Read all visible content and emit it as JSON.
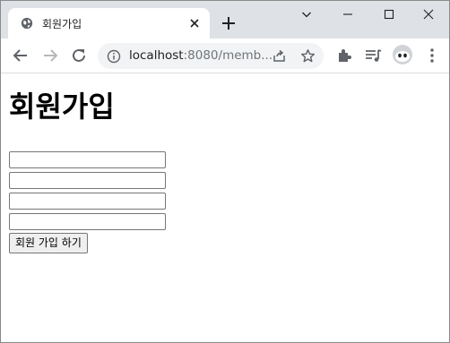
{
  "browser": {
    "tab": {
      "title": "회원가입"
    },
    "address_bar": {
      "host": "localhost",
      "rest": ":8080/memb..."
    },
    "accent_colors": {
      "tabstrip": "#dee1e6",
      "omnibox": "#f1f3f4"
    }
  },
  "page": {
    "title": "회원가입",
    "fields": [
      {
        "value": "",
        "placeholder": ""
      },
      {
        "value": "",
        "placeholder": ""
      },
      {
        "value": "",
        "placeholder": ""
      },
      {
        "value": "",
        "placeholder": ""
      }
    ],
    "submit_label": "회원 가입 하기"
  },
  "icons": {
    "favicon": "globe-icon",
    "tab_close": "close-icon",
    "new_tab": "plus-icon",
    "tab_search": "chevron-down-icon",
    "minimize": "minimize-icon",
    "maximize": "maximize-icon",
    "close_window": "close-icon",
    "back": "arrow-left-icon",
    "forward": "arrow-right-icon",
    "reload": "reload-icon",
    "site_info": "info-icon",
    "share": "share-icon",
    "bookmark": "star-icon",
    "extensions": "puzzle-icon",
    "media": "media-playlist-icon",
    "profile": "avatar",
    "menu": "kebab-menu-icon"
  }
}
